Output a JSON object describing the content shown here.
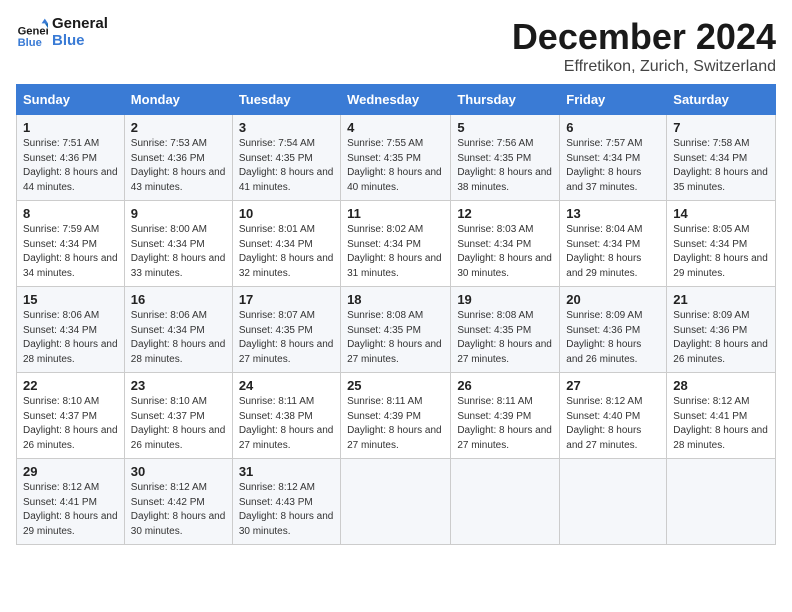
{
  "logo": {
    "line1": "General",
    "line2": "Blue"
  },
  "title": "December 2024",
  "location": "Effretikon, Zurich, Switzerland",
  "days_of_week": [
    "Sunday",
    "Monday",
    "Tuesday",
    "Wednesday",
    "Thursday",
    "Friday",
    "Saturday"
  ],
  "weeks": [
    [
      {
        "day": "1",
        "sunrise": "Sunrise: 7:51 AM",
        "sunset": "Sunset: 4:36 PM",
        "daylight": "Daylight: 8 hours and 44 minutes."
      },
      {
        "day": "2",
        "sunrise": "Sunrise: 7:53 AM",
        "sunset": "Sunset: 4:36 PM",
        "daylight": "Daylight: 8 hours and 43 minutes."
      },
      {
        "day": "3",
        "sunrise": "Sunrise: 7:54 AM",
        "sunset": "Sunset: 4:35 PM",
        "daylight": "Daylight: 8 hours and 41 minutes."
      },
      {
        "day": "4",
        "sunrise": "Sunrise: 7:55 AM",
        "sunset": "Sunset: 4:35 PM",
        "daylight": "Daylight: 8 hours and 40 minutes."
      },
      {
        "day": "5",
        "sunrise": "Sunrise: 7:56 AM",
        "sunset": "Sunset: 4:35 PM",
        "daylight": "Daylight: 8 hours and 38 minutes."
      },
      {
        "day": "6",
        "sunrise": "Sunrise: 7:57 AM",
        "sunset": "Sunset: 4:34 PM",
        "daylight": "Daylight: 8 hours and 37 minutes."
      },
      {
        "day": "7",
        "sunrise": "Sunrise: 7:58 AM",
        "sunset": "Sunset: 4:34 PM",
        "daylight": "Daylight: 8 hours and 35 minutes."
      }
    ],
    [
      {
        "day": "8",
        "sunrise": "Sunrise: 7:59 AM",
        "sunset": "Sunset: 4:34 PM",
        "daylight": "Daylight: 8 hours and 34 minutes."
      },
      {
        "day": "9",
        "sunrise": "Sunrise: 8:00 AM",
        "sunset": "Sunset: 4:34 PM",
        "daylight": "Daylight: 8 hours and 33 minutes."
      },
      {
        "day": "10",
        "sunrise": "Sunrise: 8:01 AM",
        "sunset": "Sunset: 4:34 PM",
        "daylight": "Daylight: 8 hours and 32 minutes."
      },
      {
        "day": "11",
        "sunrise": "Sunrise: 8:02 AM",
        "sunset": "Sunset: 4:34 PM",
        "daylight": "Daylight: 8 hours and 31 minutes."
      },
      {
        "day": "12",
        "sunrise": "Sunrise: 8:03 AM",
        "sunset": "Sunset: 4:34 PM",
        "daylight": "Daylight: 8 hours and 30 minutes."
      },
      {
        "day": "13",
        "sunrise": "Sunrise: 8:04 AM",
        "sunset": "Sunset: 4:34 PM",
        "daylight": "Daylight: 8 hours and 29 minutes."
      },
      {
        "day": "14",
        "sunrise": "Sunrise: 8:05 AM",
        "sunset": "Sunset: 4:34 PM",
        "daylight": "Daylight: 8 hours and 29 minutes."
      }
    ],
    [
      {
        "day": "15",
        "sunrise": "Sunrise: 8:06 AM",
        "sunset": "Sunset: 4:34 PM",
        "daylight": "Daylight: 8 hours and 28 minutes."
      },
      {
        "day": "16",
        "sunrise": "Sunrise: 8:06 AM",
        "sunset": "Sunset: 4:34 PM",
        "daylight": "Daylight: 8 hours and 28 minutes."
      },
      {
        "day": "17",
        "sunrise": "Sunrise: 8:07 AM",
        "sunset": "Sunset: 4:35 PM",
        "daylight": "Daylight: 8 hours and 27 minutes."
      },
      {
        "day": "18",
        "sunrise": "Sunrise: 8:08 AM",
        "sunset": "Sunset: 4:35 PM",
        "daylight": "Daylight: 8 hours and 27 minutes."
      },
      {
        "day": "19",
        "sunrise": "Sunrise: 8:08 AM",
        "sunset": "Sunset: 4:35 PM",
        "daylight": "Daylight: 8 hours and 27 minutes."
      },
      {
        "day": "20",
        "sunrise": "Sunrise: 8:09 AM",
        "sunset": "Sunset: 4:36 PM",
        "daylight": "Daylight: 8 hours and 26 minutes."
      },
      {
        "day": "21",
        "sunrise": "Sunrise: 8:09 AM",
        "sunset": "Sunset: 4:36 PM",
        "daylight": "Daylight: 8 hours and 26 minutes."
      }
    ],
    [
      {
        "day": "22",
        "sunrise": "Sunrise: 8:10 AM",
        "sunset": "Sunset: 4:37 PM",
        "daylight": "Daylight: 8 hours and 26 minutes."
      },
      {
        "day": "23",
        "sunrise": "Sunrise: 8:10 AM",
        "sunset": "Sunset: 4:37 PM",
        "daylight": "Daylight: 8 hours and 26 minutes."
      },
      {
        "day": "24",
        "sunrise": "Sunrise: 8:11 AM",
        "sunset": "Sunset: 4:38 PM",
        "daylight": "Daylight: 8 hours and 27 minutes."
      },
      {
        "day": "25",
        "sunrise": "Sunrise: 8:11 AM",
        "sunset": "Sunset: 4:39 PM",
        "daylight": "Daylight: 8 hours and 27 minutes."
      },
      {
        "day": "26",
        "sunrise": "Sunrise: 8:11 AM",
        "sunset": "Sunset: 4:39 PM",
        "daylight": "Daylight: 8 hours and 27 minutes."
      },
      {
        "day": "27",
        "sunrise": "Sunrise: 8:12 AM",
        "sunset": "Sunset: 4:40 PM",
        "daylight": "Daylight: 8 hours and 27 minutes."
      },
      {
        "day": "28",
        "sunrise": "Sunrise: 8:12 AM",
        "sunset": "Sunset: 4:41 PM",
        "daylight": "Daylight: 8 hours and 28 minutes."
      }
    ],
    [
      {
        "day": "29",
        "sunrise": "Sunrise: 8:12 AM",
        "sunset": "Sunset: 4:41 PM",
        "daylight": "Daylight: 8 hours and 29 minutes."
      },
      {
        "day": "30",
        "sunrise": "Sunrise: 8:12 AM",
        "sunset": "Sunset: 4:42 PM",
        "daylight": "Daylight: 8 hours and 30 minutes."
      },
      {
        "day": "31",
        "sunrise": "Sunrise: 8:12 AM",
        "sunset": "Sunset: 4:43 PM",
        "daylight": "Daylight: 8 hours and 30 minutes."
      },
      null,
      null,
      null,
      null
    ]
  ]
}
